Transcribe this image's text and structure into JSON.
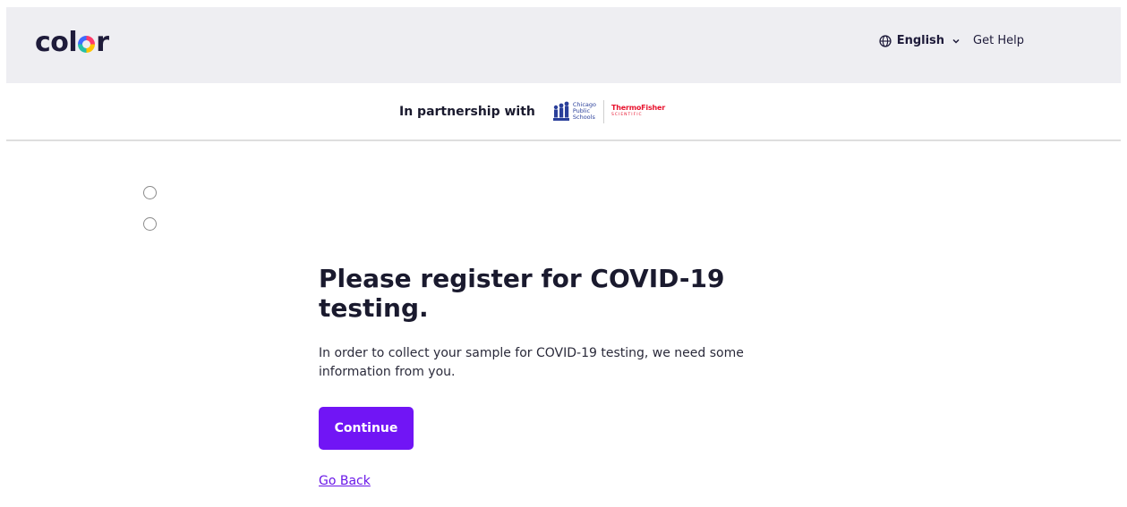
{
  "header": {
    "logo_text_before": "col",
    "logo_text_after": "r",
    "language_label": "English",
    "help_label": "Get Help"
  },
  "partnership": {
    "label": "In partnership with",
    "cps_lines": [
      "Chicago",
      "Public",
      "Schools"
    ],
    "tf_name": "ThermoFisher",
    "tf_sub": "SCIENTIFIC"
  },
  "main": {
    "title": "Please register for COVID-19 testing.",
    "body": "In order to collect your sample for COVID-19 testing, we need some information from you.",
    "continue_label": "Continue",
    "back_label": "Go Back"
  },
  "colors": {
    "accent": "#7115f5",
    "link": "#6a17e8",
    "header_bg": "#eeeef2"
  }
}
